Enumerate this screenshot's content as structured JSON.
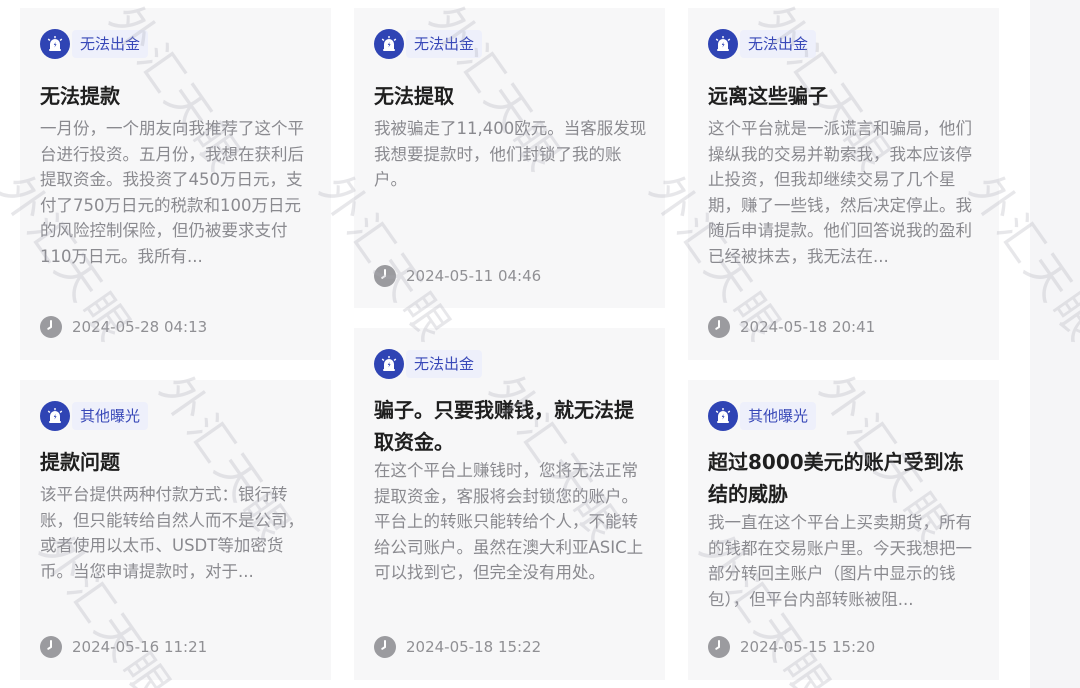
{
  "cards": [
    {
      "tag": "无法出金",
      "title": "无法提款",
      "body": "一月份，一个朋友向我推荐了这个平台进行投资。五月份，我想在获利后提取资金。我投资了450万日元，支付了750万日元的税款和100万日元的风险控制保险，但仍被要求支付110万日元。我所有...",
      "time": "2024-05-28 04:13"
    },
    {
      "tag": "其他曝光",
      "title": "提款问题",
      "body": "该平台提供两种付款方式：银行转账，但只能转给自然人而不是公司，或者使用以太币、USDT等加密货币。当您申请提款时，对于...",
      "time": "2024-05-16 11:21"
    },
    {
      "tag": "无法出金",
      "title": "无法提取",
      "body": "我被骗走了11,400欧元。当客服发现我想要提款时，他们封锁了我的账户。",
      "time": "2024-05-11 04:46"
    },
    {
      "tag": "无法出金",
      "title": "骗子。只要我赚钱，就无法提取资金。",
      "body": "在这个平台上赚钱时，您将无法正常提取资金，客服将会封锁您的账户。平台上的转账只能转给个人，不能转给公司账户。虽然在澳大利亚ASIC上可以找到它，但完全没有用处。",
      "time": "2024-05-18 15:22"
    },
    {
      "tag": "无法出金",
      "title": "远离这些骗子",
      "body": "这个平台就是一派谎言和骗局，他们操纵我的交易并勒索我，我本应该停止投资，但我却继续交易了几个星期，赚了一些钱，然后决定停止。我随后申请提款。他们回答说我的盈利已经被抹去，我无法在...",
      "time": "2024-05-18 20:41"
    },
    {
      "tag": "其他曝光",
      "title": "超过8000美元的账户受到冻结的威胁",
      "body": "我一直在这个平台上买卖期货，所有的钱都在交易账户里。今天我想把一部分转回主账户（图片中显示的钱包），但平台内部转账被阻...",
      "time": "2024-05-15 15:20"
    }
  ],
  "watermark": "外汇天眼",
  "icons": {
    "tag": "alarm-bell-icon",
    "time": "clock-icon"
  },
  "colors": {
    "accent": "#2f44b4",
    "tag_bg": "#eef0fb",
    "card_bg": "#f7f7f8"
  }
}
